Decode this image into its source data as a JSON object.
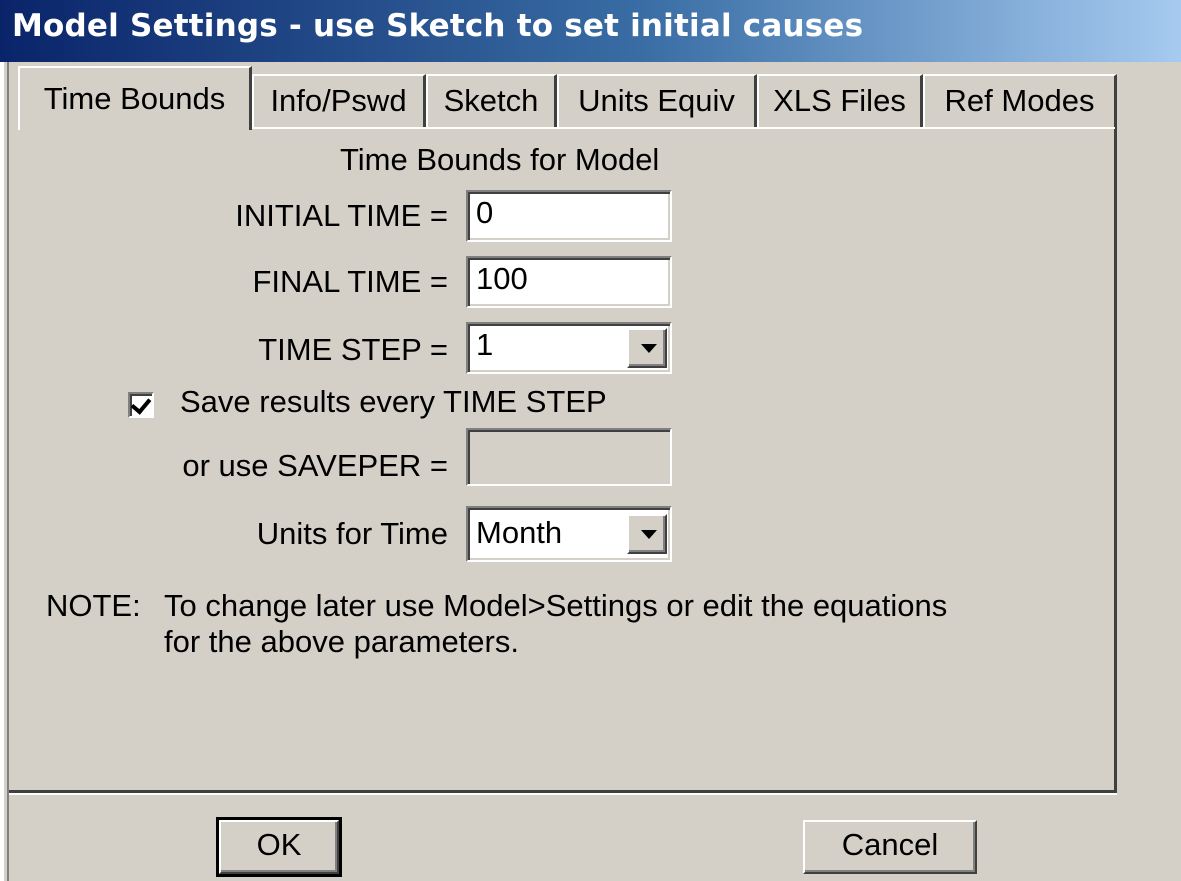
{
  "window": {
    "title": "Model Settings - use Sketch to set initial causes"
  },
  "tabs": [
    {
      "label": "Time Bounds",
      "active": true
    },
    {
      "label": "Info/Pswd",
      "active": false
    },
    {
      "label": "Sketch",
      "active": false
    },
    {
      "label": "Units Equiv",
      "active": false
    },
    {
      "label": "XLS Files",
      "active": false
    },
    {
      "label": "Ref Modes",
      "active": false
    }
  ],
  "panel": {
    "heading": "Time Bounds for Model",
    "initial_time": {
      "label": "INITIAL TIME =",
      "value": "0"
    },
    "final_time": {
      "label": "FINAL TIME =",
      "value": "100"
    },
    "time_step": {
      "label": "TIME STEP =",
      "value": "1"
    },
    "save_results": {
      "label": "Save results every TIME STEP",
      "checked": true
    },
    "saveper": {
      "label": "or use SAVEPER =",
      "value": "",
      "enabled": false
    },
    "units_for_time": {
      "label": "Units for Time",
      "value": "Month"
    },
    "note": {
      "prefix": "NOTE:",
      "line1": "To change later use Model>Settings or edit the equations",
      "line2": "for the above parameters."
    }
  },
  "buttons": {
    "ok": "OK",
    "cancel": "Cancel"
  },
  "icons": {
    "dropdown": "chevron-down-icon",
    "check": "check-icon"
  },
  "colors": {
    "title_start": "#0a246a",
    "title_end": "#a6caf0",
    "face": "#d4d0c8"
  }
}
